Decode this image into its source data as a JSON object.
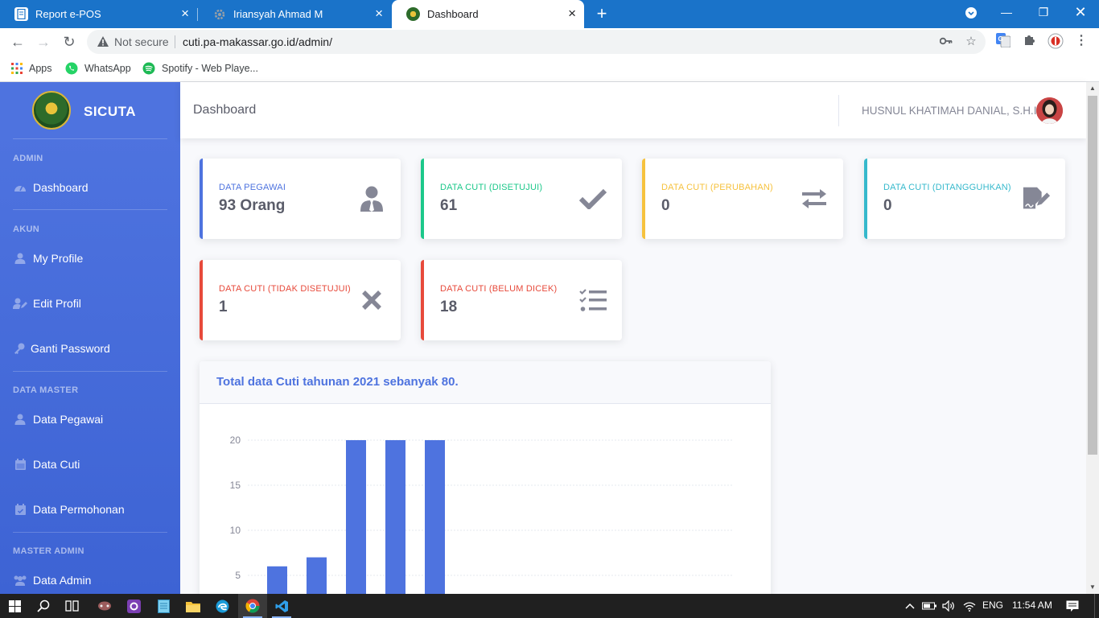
{
  "browser": {
    "tabs": [
      {
        "title": "Report e-POS",
        "active": false
      },
      {
        "title": "Iriansyah Ahmad M",
        "active": false
      },
      {
        "title": "Dashboard",
        "active": true
      }
    ],
    "security_status": "Not secure",
    "url": "cuti.pa-makassar.go.id/admin/",
    "bookmarks": [
      {
        "label": "Apps",
        "icon": "apps-grid-icon"
      },
      {
        "label": "WhatsApp",
        "icon": "whatsapp-icon"
      },
      {
        "label": "Spotify - Web Playe...",
        "icon": "spotify-icon"
      }
    ]
  },
  "sidebar": {
    "brand": "SICUTA",
    "sections": [
      {
        "heading": "ADMIN",
        "items": [
          {
            "label": "Dashboard",
            "icon": "tachometer-icon"
          }
        ]
      },
      {
        "heading": "AKUN",
        "items": [
          {
            "label": "My Profile",
            "icon": "user-icon"
          },
          {
            "label": "Edit Profil",
            "icon": "user-edit-icon"
          },
          {
            "label": "Ganti Password",
            "icon": "key-icon"
          }
        ]
      },
      {
        "heading": "DATA MASTER",
        "items": [
          {
            "label": "Data Pegawai",
            "icon": "user-icon"
          },
          {
            "label": "Data Cuti",
            "icon": "calendar-icon"
          },
          {
            "label": "Data Permohonan",
            "icon": "calendar-check-icon"
          }
        ]
      },
      {
        "heading": "MASTER ADMIN",
        "items": [
          {
            "label": "Data Admin",
            "icon": "users-icon"
          }
        ]
      }
    ]
  },
  "topbar": {
    "title": "Dashboard",
    "user_name": "HUSNUL KHATIMAH DANIAL, S.H.I."
  },
  "cards": [
    {
      "label": "DATA PEGAWAI",
      "value": "93 Orang",
      "color": "#4e73df",
      "icon": "user-tie-icon"
    },
    {
      "label": "DATA CUTI (DISETUJUI)",
      "value": "61",
      "color": "#1cc88a",
      "icon": "check-icon"
    },
    {
      "label": "DATA CUTI (PERUBAHAN)",
      "value": "0",
      "color": "#f6c23e",
      "icon": "exchange-icon"
    },
    {
      "label": "DATA CUTI (DITANGGUHKAN)",
      "value": "0",
      "color": "#36b9cc",
      "icon": "file-signature-icon"
    },
    {
      "label": "DATA CUTI (TIDAK DISETUJUI)",
      "value": "1",
      "color": "#e74a3b",
      "icon": "times-icon"
    },
    {
      "label": "DATA CUTI (BELUM DICEK)",
      "value": "18",
      "color": "#e74a3b",
      "icon": "tasks-icon"
    }
  ],
  "chart_panel": {
    "title": "Total data Cuti tahunan 2021 sebanyak 80."
  },
  "chart_data": {
    "type": "bar",
    "title": "",
    "xlabel": "",
    "ylabel": "",
    "y_ticks": [
      5,
      10,
      15,
      20
    ],
    "ylim": [
      0,
      20
    ],
    "values": [
      6,
      7,
      20,
      20,
      20
    ],
    "color": "#4e73df",
    "grid": true
  },
  "taskbar": {
    "language": "ENG",
    "time": "11:54 AM"
  }
}
